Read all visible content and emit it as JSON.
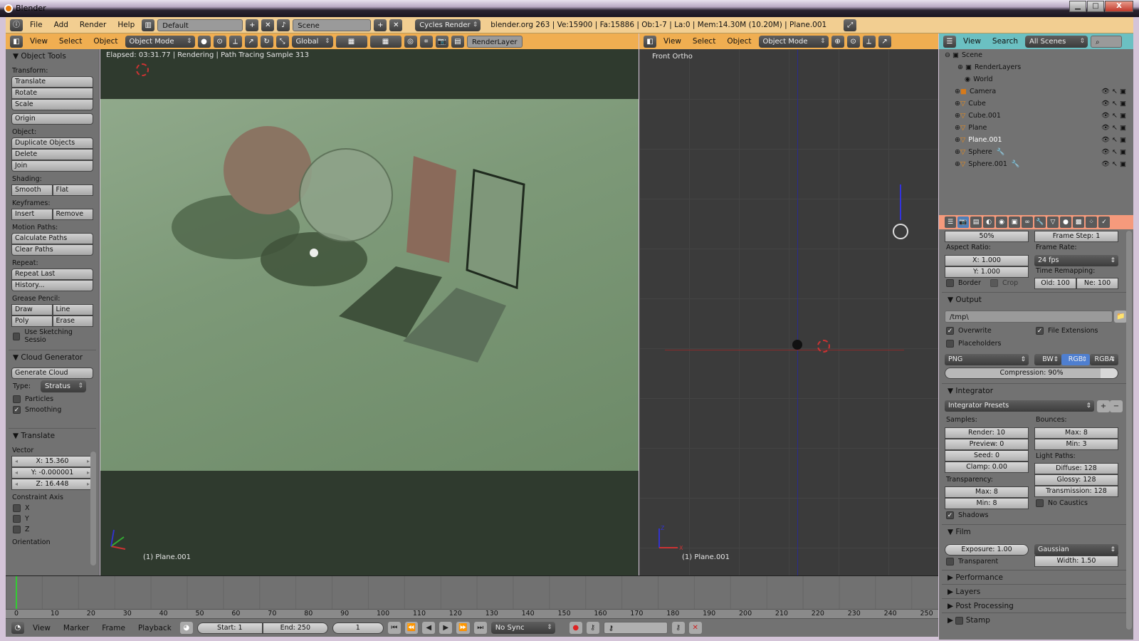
{
  "window": {
    "title": "Blender",
    "controls": [
      "minimize",
      "maximize",
      "close"
    ]
  },
  "info_header": {
    "menus": [
      "File",
      "Add",
      "Render",
      "Help"
    ],
    "screen_layout": "Default",
    "scene": "Scene",
    "engine": "Cycles Render",
    "stats": "blender.org 263 | Ve:15900 | Fa:15886 | Ob:1-7 | La:0 | Mem:14.30M (10.20M) | Plane.001"
  },
  "viewport_header": {
    "menus": [
      "View",
      "Select",
      "Object"
    ],
    "mode": "Object Mode",
    "orientation": "Global",
    "render_layer": "RenderLayer"
  },
  "front_header": {
    "menus": [
      "View",
      "Select",
      "Object"
    ],
    "mode": "Object Mode"
  },
  "outliner_header": {
    "menus": [
      "View",
      "Search"
    ],
    "filter": "All Scenes"
  },
  "toolshelf": {
    "title": "Object Tools",
    "transform_label": "Transform:",
    "transform": [
      "Translate",
      "Rotate",
      "Scale"
    ],
    "origin": "Origin",
    "object_label": "Object:",
    "object": [
      "Duplicate Objects",
      "Delete",
      "Join"
    ],
    "shading_label": "Shading:",
    "shading": [
      "Smooth",
      "Flat"
    ],
    "keyframes_label": "Keyframes:",
    "keyframes": [
      "Insert",
      "Remove"
    ],
    "motion_label": "Motion Paths:",
    "motion": [
      "Calculate Paths",
      "Clear Paths"
    ],
    "repeat_label": "Repeat:",
    "repeat": [
      "Repeat Last",
      "History..."
    ],
    "grease_label": "Grease Pencil:",
    "grease": [
      "Draw",
      "Line",
      "Poly",
      "Erase"
    ],
    "sketch": "Use Sketching Sessio",
    "cloud_title": "Cloud Generator",
    "generate": "Generate Cloud",
    "type_label": "Type:",
    "type_value": "Stratus",
    "particles": "Particles",
    "smoothing": "Smoothing",
    "smoothing_checked": true,
    "translate_title": "Translate",
    "vector_label": "Vector",
    "vector": [
      "X: 15.360",
      "Y: -0.000001",
      "Z: 16.448"
    ],
    "constraint_label": "Constraint Axis",
    "axes": [
      "X",
      "Y",
      "Z"
    ],
    "orientation": "Orientation"
  },
  "viewport": {
    "status": "Elapsed: 03:31.77 | Rendering | Path Tracing Sample 313",
    "object_label": "(1) Plane.001"
  },
  "front_view": {
    "title": "Front Ortho",
    "object_label": "(1) Plane.001",
    "axis_x": "X",
    "axis_z": "Z"
  },
  "outliner": {
    "items": [
      {
        "name": "Scene",
        "level": 0
      },
      {
        "name": "RenderLayers",
        "level": 1
      },
      {
        "name": "World",
        "level": 1
      },
      {
        "name": "Camera",
        "level": 1
      },
      {
        "name": "Cube",
        "level": 1
      },
      {
        "name": "Cube.001",
        "level": 1
      },
      {
        "name": "Plane",
        "level": 1
      },
      {
        "name": "Plane.001",
        "level": 1,
        "selected": true
      },
      {
        "name": "Sphere",
        "level": 1
      },
      {
        "name": "Sphere.001",
        "level": 1
      }
    ]
  },
  "properties": {
    "tabs": [
      "render",
      "render-layers",
      "scene",
      "world",
      "object",
      "constraints",
      "modifiers",
      "data",
      "material",
      "texture",
      "particles",
      "physics"
    ],
    "resolution_pct": "50%",
    "frame_step": "Frame Step: 1",
    "aspect_label": "Aspect Ratio:",
    "aspect_x": "X: 1.000",
    "aspect_y": "Y: 1.000",
    "framerate_label": "Frame Rate:",
    "framerate": "24 fps",
    "remap_label": "Time Remapping:",
    "remap_old": "Old: 100",
    "remap_new": "Ne: 100",
    "border": "Border",
    "crop": "Crop",
    "output_title": "Output",
    "output_path": "/tmp\\",
    "overwrite": "Overwrite",
    "file_ext": "File Extensions",
    "placeholders": "Placeholders",
    "format": "PNG",
    "color_modes": [
      "BW",
      "RGB",
      "RGBA"
    ],
    "color_mode_selected": "RGB",
    "compression": "Compression: 90%",
    "compression_value": 0.9,
    "integrator_title": "Integrator",
    "presets": "Integrator Presets",
    "samples_label": "Samples:",
    "samples": [
      "Render: 10",
      "Preview: 0",
      "Seed: 0",
      "Clamp: 0.00"
    ],
    "bounces_label": "Bounces:",
    "bounces": [
      "Max: 8",
      "Min: 3"
    ],
    "lightpaths_label": "Light Paths:",
    "lightpaths": [
      "Diffuse: 128",
      "Glossy: 128",
      "Transmission: 128"
    ],
    "transp_label": "Transparency:",
    "transp": [
      "Max: 8",
      "Min: 8"
    ],
    "no_caustics": "No Caustics",
    "shadows": "Shadows",
    "film_title": "Film",
    "exposure": "Exposure: 1.00",
    "filter": "Gaussian",
    "width": "Width: 1.50",
    "transparent": "Transparent",
    "collapsed": [
      "Performance",
      "Layers",
      "Post Processing",
      "Stamp"
    ]
  },
  "timeline": {
    "ticks": [
      "0",
      "10",
      "20",
      "30",
      "40",
      "50",
      "60",
      "70",
      "80",
      "90",
      "100",
      "110",
      "120",
      "130",
      "140",
      "150",
      "160",
      "170",
      "180",
      "190",
      "200",
      "210",
      "220",
      "230",
      "240",
      "250"
    ],
    "menus": [
      "View",
      "Marker",
      "Frame",
      "Playback"
    ],
    "start": "Start: 1",
    "end": "End: 250",
    "current": "1",
    "sync": "No Sync"
  }
}
